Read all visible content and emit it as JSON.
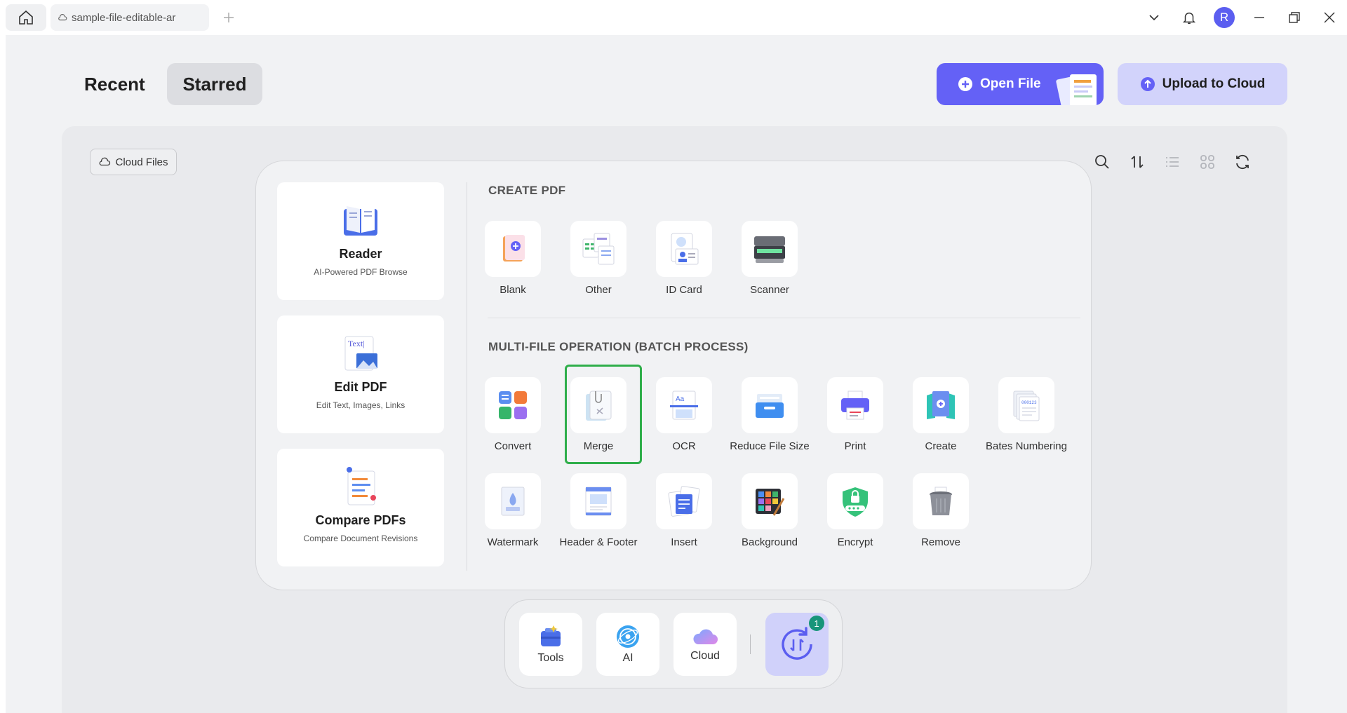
{
  "titlebar": {
    "tab_title": "sample-file-editable-ar",
    "avatar_initial": "R"
  },
  "header": {
    "tabs": [
      {
        "label": "Recent",
        "active": false
      },
      {
        "label": "Starred",
        "active": true
      }
    ],
    "open_file_label": "Open File",
    "upload_label": "Upload to Cloud",
    "accent_color": "#6461f6"
  },
  "panel": {
    "cloud_files_label": "Cloud Files"
  },
  "popup": {
    "feature_cards": [
      {
        "title": "Reader",
        "subtitle": "AI-Powered PDF Browse",
        "icon": "reader-icon"
      },
      {
        "title": "Edit PDF",
        "subtitle": "Edit Text, Images, Links",
        "icon": "edit-pdf-icon"
      },
      {
        "title": "Compare PDFs",
        "subtitle": "Compare Document Revisions",
        "icon": "compare-pdfs-icon"
      }
    ],
    "create_title": "CREATE PDF",
    "create_tools": [
      {
        "label": "Blank",
        "icon": "blank-icon"
      },
      {
        "label": "Other",
        "icon": "other-icon"
      },
      {
        "label": "ID Card",
        "icon": "id-card-icon"
      },
      {
        "label": "Scanner",
        "icon": "scanner-icon"
      }
    ],
    "batch_title": "MULTI-FILE OPERATION (BATCH PROCESS)",
    "batch_row1": [
      {
        "label": "Convert",
        "icon": "convert-icon"
      },
      {
        "label": "Merge",
        "icon": "merge-icon",
        "selected": true
      },
      {
        "label": "OCR",
        "icon": "ocr-icon"
      },
      {
        "label": "Reduce File Size",
        "icon": "reduce-file-size-icon"
      },
      {
        "label": "Print",
        "icon": "print-icon"
      },
      {
        "label": "Create",
        "icon": "create-icon"
      },
      {
        "label": "Bates Numbering",
        "icon": "bates-numbering-icon"
      }
    ],
    "batch_row2": [
      {
        "label": "Watermark",
        "icon": "watermark-icon"
      },
      {
        "label": "Header & Footer",
        "icon": "header-footer-icon"
      },
      {
        "label": "Insert",
        "icon": "insert-icon"
      },
      {
        "label": "Background",
        "icon": "background-icon"
      },
      {
        "label": "Encrypt",
        "icon": "encrypt-icon"
      },
      {
        "label": "Remove",
        "icon": "remove-icon"
      }
    ]
  },
  "dock": {
    "items": [
      {
        "label": "Tools",
        "icon": "tools-icon"
      },
      {
        "label": "AI",
        "icon": "ai-icon"
      },
      {
        "label": "Cloud",
        "icon": "cloud-icon"
      }
    ],
    "sync_badge": "1"
  }
}
